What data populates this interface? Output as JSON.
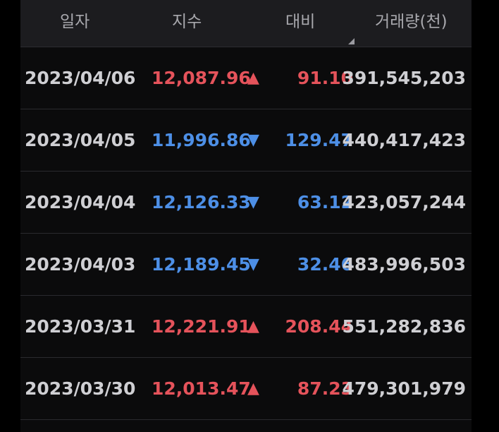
{
  "header": {
    "date": "일자",
    "index": "지수",
    "change": "대비",
    "volume": "거래량(천)"
  },
  "colors": {
    "up": "#e5535b",
    "down": "#4d8fe6"
  },
  "rows": [
    {
      "date": "2023/04/06",
      "index": "12,087.96",
      "direction": "up",
      "arrow": "▲",
      "change": "91.10",
      "volume": "391,545,203"
    },
    {
      "date": "2023/04/05",
      "index": "11,996.86",
      "direction": "down",
      "arrow": "▼",
      "change": "129.47",
      "volume": "440,417,423"
    },
    {
      "date": "2023/04/04",
      "index": "12,126.33",
      "direction": "down",
      "arrow": "▼",
      "change": "63.12",
      "volume": "423,057,244"
    },
    {
      "date": "2023/04/03",
      "index": "12,189.45",
      "direction": "down",
      "arrow": "▼",
      "change": "32.46",
      "volume": "483,996,503"
    },
    {
      "date": "2023/03/31",
      "index": "12,221.91",
      "direction": "up",
      "arrow": "▲",
      "change": "208.44",
      "volume": "551,282,836"
    },
    {
      "date": "2023/03/30",
      "index": "12,013.47",
      "direction": "up",
      "arrow": "▲",
      "change": "87.23",
      "volume": "479,301,979"
    }
  ]
}
